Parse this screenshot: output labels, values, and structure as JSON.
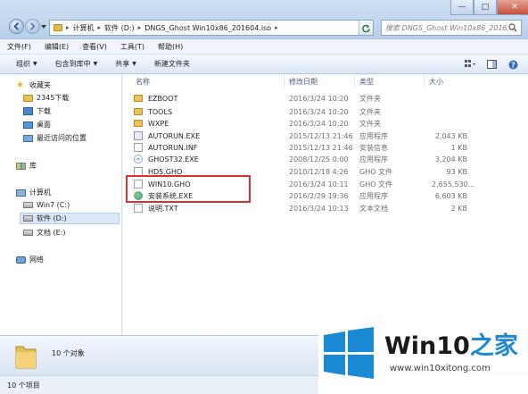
{
  "window": {
    "controls": {
      "minimize": "—",
      "maximize": "□",
      "close": "✕"
    },
    "address_crumbs": [
      "计算机",
      "软件 (D:)",
      "DNGS_Ghost Win10x86_201604.iso"
    ],
    "search_placeholder": "搜索 DNGS_Ghost Win10x86_2016..."
  },
  "menu": [
    "文件(F)",
    "编辑(E)",
    "查看(V)",
    "工具(T)",
    "帮助(H)"
  ],
  "toolbar": [
    {
      "label": "组织",
      "has_caret": true
    },
    {
      "label": "包含到库中",
      "has_caret": true
    },
    {
      "label": "共享",
      "has_caret": true
    },
    {
      "label": "新建文件夹",
      "has_caret": false
    }
  ],
  "nav": {
    "favorites": {
      "label": "收藏夹",
      "items": [
        "2345下载",
        "下载",
        "桌面",
        "最近访问的位置"
      ]
    },
    "library": {
      "label": "库"
    },
    "computer": {
      "label": "计算机",
      "items": [
        "Win7 (C:)",
        "软件 (D:)",
        "文档 (E:)"
      ],
      "selected": "软件 (D:)"
    },
    "network": {
      "label": "网络"
    }
  },
  "columns": [
    "名称",
    "修改日期",
    "类型",
    "大小"
  ],
  "files": [
    {
      "name": "EZBOOT",
      "date": "2016/3/24 10:20",
      "type": "文件夹",
      "size": "",
      "icon": "folder-icon"
    },
    {
      "name": "TOOLS",
      "date": "2016/3/24 10:20",
      "type": "文件夹",
      "size": "",
      "icon": "folder-icon"
    },
    {
      "name": "WXPE",
      "date": "2016/3/24 10:20",
      "type": "文件夹",
      "size": "",
      "icon": "folder-icon"
    },
    {
      "name": "AUTORUN.EXE",
      "date": "2015/12/13 21:46",
      "type": "应用程序",
      "size": "2,043 KB",
      "icon": "exe-icon"
    },
    {
      "name": "AUTORUN.INF",
      "date": "2015/12/13 21:46",
      "type": "安装信息",
      "size": "1 KB",
      "icon": "inf-icon"
    },
    {
      "name": "GHOST32.EXE",
      "date": "2008/12/25 0:00",
      "type": "应用程序",
      "size": "3,204 KB",
      "icon": "ghost-icon"
    },
    {
      "name": "HD5.GHO",
      "date": "2010/12/18 4:26",
      "type": "GHO 文件",
      "size": "93 KB",
      "icon": "gho-icon"
    },
    {
      "name": "WIN10.GHO",
      "date": "2016/3/24 10:11",
      "type": "GHO 文件",
      "size": "2,655,530...",
      "icon": "gho-icon"
    },
    {
      "name": "安装系统.EXE",
      "date": "2016/2/29 19:36",
      "type": "应用程序",
      "size": "6,603 KB",
      "icon": "setup-icon"
    },
    {
      "name": "说明.TXT",
      "date": "2016/3/24 10:13",
      "type": "文本文档",
      "size": "2 KB",
      "icon": "txt-icon"
    }
  ],
  "details": {
    "count": "10 个对象"
  },
  "status": {
    "count": "10 个项目"
  },
  "watermark": {
    "brand": "Win10",
    "brand_zh": "之家",
    "url": "www.win10xitong.com"
  },
  "colors": {
    "highlight": "#d63232",
    "accent": "#1e88d4"
  }
}
